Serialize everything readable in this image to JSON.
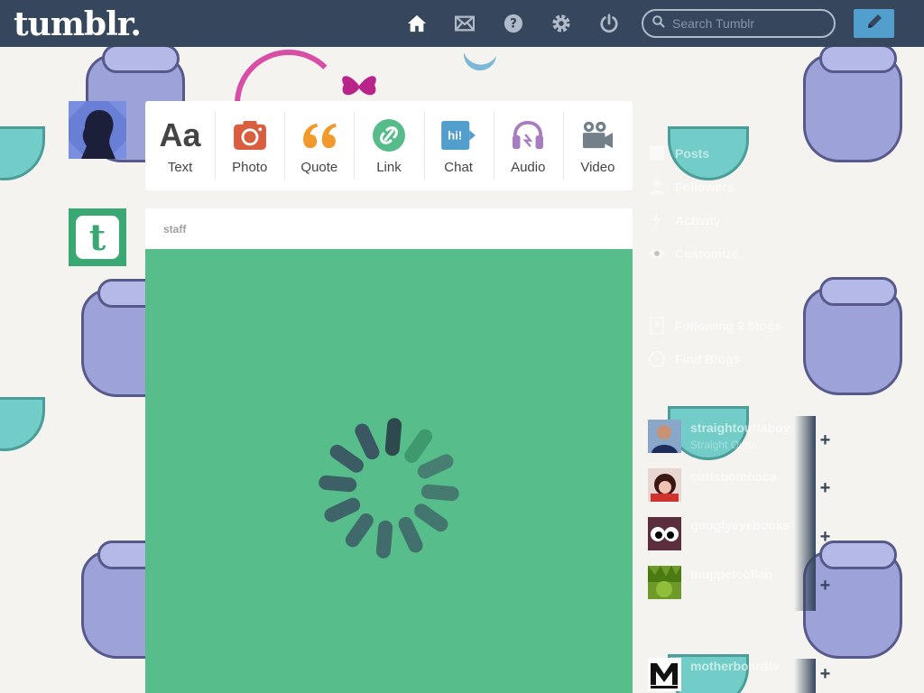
{
  "header": {
    "logo": "tumblr.",
    "search_placeholder": "Search Tumblr",
    "icons": [
      "home-icon",
      "mail-icon",
      "help-icon",
      "gear-icon",
      "power-icon",
      "pencil-icon"
    ]
  },
  "post_types": [
    {
      "label": "Text",
      "icon": "text-icon",
      "color": "#444444"
    },
    {
      "label": "Photo",
      "icon": "camera-icon",
      "color": "#d95e40"
    },
    {
      "label": "Quote",
      "icon": "quote-icon",
      "color": "#f2992e"
    },
    {
      "label": "Link",
      "icon": "link-icon",
      "color": "#56bc8a"
    },
    {
      "label": "Chat",
      "icon": "chat-icon",
      "color": "#529ecc"
    },
    {
      "label": "Audio",
      "icon": "headphones-icon",
      "color": "#a77dc2"
    },
    {
      "label": "Video",
      "icon": "video-camera-icon",
      "color": "#748089"
    }
  ],
  "post": {
    "author": "staff",
    "body_color": "#57bd8a"
  },
  "sidebar": {
    "items": [
      {
        "label": "Posts",
        "icon": "posts-icon"
      },
      {
        "label": "Followers",
        "icon": "followers-icon"
      },
      {
        "label": "Activity",
        "icon": "activity-icon"
      },
      {
        "label": "Customize",
        "icon": "eye-icon"
      }
    ],
    "following": "Following 2 blogs",
    "find_blogs": "Find Blogs",
    "recommended": [
      {
        "name": "straightouttaboy",
        "sub": "Straight Outta"
      },
      {
        "name": "curlsbomboca",
        "sub": ""
      },
      {
        "name": "googlyeyebooks",
        "sub": ""
      },
      {
        "name": "muppetcollab",
        "sub": ""
      }
    ],
    "radar": {
      "name": "motherboardtv"
    }
  },
  "colors": {
    "header": "#36465d",
    "accent": "#529ecc",
    "staff_green": "#3aa872"
  }
}
